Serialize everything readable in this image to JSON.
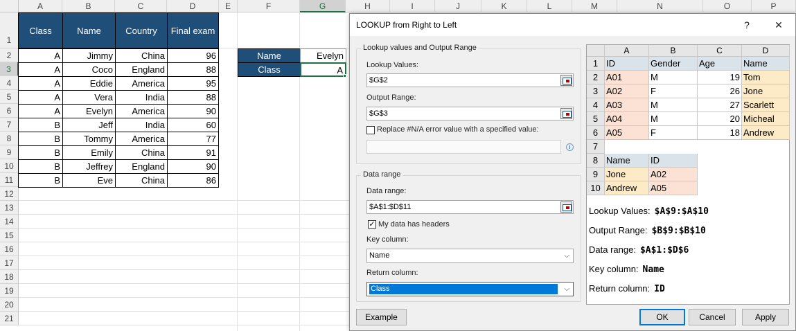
{
  "sheet": {
    "columns": [
      "A",
      "B",
      "C",
      "D",
      "E",
      "F",
      "G",
      "H",
      "I",
      "J",
      "K",
      "L",
      "M",
      "N",
      "O",
      "P"
    ],
    "rows": [
      "1",
      "2",
      "3",
      "4",
      "5",
      "6",
      "7",
      "8",
      "9",
      "10",
      "11",
      "12",
      "13",
      "14",
      "15",
      "16",
      "17",
      "18",
      "19",
      "20",
      "21"
    ],
    "table_headers": [
      "Class",
      "Name",
      "Country",
      "Final exam"
    ],
    "table_rows": [
      [
        "A",
        "Jimmy",
        "China",
        "96"
      ],
      [
        "A",
        "Coco",
        "England",
        "88"
      ],
      [
        "A",
        "Eddie",
        "America",
        "95"
      ],
      [
        "A",
        "Vera",
        "India",
        "88"
      ],
      [
        "A",
        "Evelyn",
        "America",
        "90"
      ],
      [
        "B",
        "Jeff",
        "India",
        "60"
      ],
      [
        "B",
        "Tommy",
        "America",
        "77"
      ],
      [
        "B",
        "Emily",
        "China",
        "91"
      ],
      [
        "B",
        "Jeffrey",
        "England",
        "90"
      ],
      [
        "B",
        "Eve",
        "China",
        "86"
      ]
    ],
    "lookup_keys": [
      "Name",
      "Class"
    ],
    "lookup_values": [
      "Evelyn",
      "A"
    ],
    "header_fill": "#1f4e79",
    "accent": "#1e7145"
  },
  "dialog": {
    "title": "LOOKUP from Right to Left",
    "help": "?",
    "close": "✕",
    "group1_title": "Lookup values and Output Range",
    "lookup_values_label": "Lookup Values:",
    "lookup_values_value": "$G$2",
    "output_range_label": "Output Range:",
    "output_range_value": "$G$3",
    "replace_label": "Replace #N/A error value with a specified value:",
    "replace_value": "",
    "group2_title": "Data range",
    "data_range_label": "Data range:",
    "data_range_value": "$A$1:$D$11",
    "headers_label": "My data has headers",
    "headers_checked": "✓",
    "key_column_label": "Key column:",
    "key_column_value": "Name",
    "return_column_label": "Return column:",
    "return_column_value": "Class",
    "example_button": "Example",
    "ok_button": "OK",
    "cancel_button": "Cancel",
    "apply_button": "Apply",
    "info": "i",
    "chevron": "⌵",
    "accent": "#0078d7"
  },
  "example": {
    "columns": [
      "A",
      "B",
      "C",
      "D"
    ],
    "rows": [
      "1",
      "2",
      "3",
      "4",
      "5",
      "6",
      "7",
      "8",
      "9",
      "10"
    ],
    "table": [
      [
        "ID",
        "Gender",
        "Age",
        "Name"
      ],
      [
        "A01",
        "M",
        "19",
        "Tom"
      ],
      [
        "A02",
        "F",
        "26",
        "Jone"
      ],
      [
        "A03",
        "M",
        "27",
        "Scarlett"
      ],
      [
        "A04",
        "M",
        "20",
        "Micheal"
      ],
      [
        "A05",
        "F",
        "18",
        "Andrew"
      ]
    ],
    "result_headers": [
      "Name",
      "ID"
    ],
    "result_rows": [
      [
        "Jone",
        "A02"
      ],
      [
        "Andrew",
        "A05"
      ]
    ],
    "lines": [
      {
        "label": "Lookup Values:",
        "value": "$A$9:$A$10"
      },
      {
        "label": "Output Range:",
        "value": "$B$9:$B$10"
      },
      {
        "label": "Data range:",
        "value": "$A$1:$D$6"
      },
      {
        "label": "Key column:",
        "value": "Name"
      },
      {
        "label": "Return column:",
        "value": "ID"
      }
    ]
  }
}
